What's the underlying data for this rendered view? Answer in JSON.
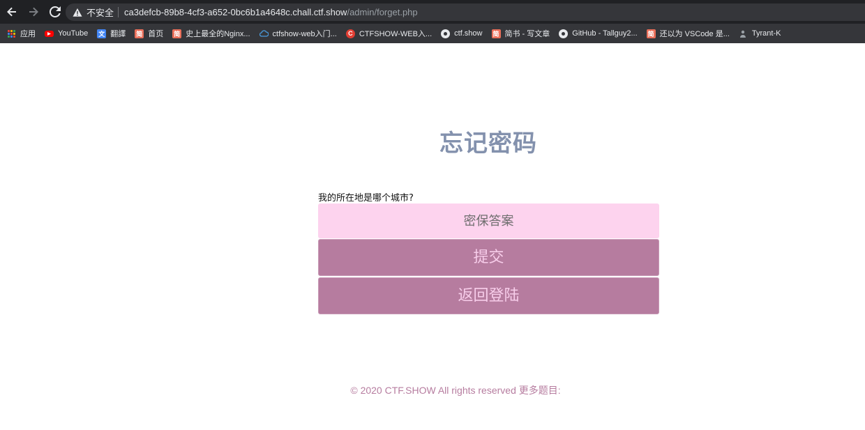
{
  "browser": {
    "security_label": "不安全",
    "url_host": "ca3defcb-89b8-4cf3-a652-0bc6b1a4648c.chall.ctf.show",
    "url_path": "/admin/forget.php",
    "bookmarks": [
      {
        "label": "应用",
        "icon": "apps-grid-icon"
      },
      {
        "label": "YouTube",
        "icon": "youtube-icon",
        "color": "#ff0000"
      },
      {
        "label": "翻譯",
        "icon": "translate-icon",
        "color": "#4285f4"
      },
      {
        "label": "首页",
        "icon": "jianshu-icon",
        "color": "#ea6f5a"
      },
      {
        "label": "史上最全的Nginx...",
        "icon": "jianshu-icon",
        "color": "#ea6f5a"
      },
      {
        "label": "ctfshow-web入门...",
        "icon": "cloud-icon",
        "color": "#4a9de0"
      },
      {
        "label": "CTFSHOW-WEB入...",
        "icon": "csdn-icon",
        "color": "#e33e33"
      },
      {
        "label": "ctf.show",
        "icon": "globe-icon",
        "color": "#e8eaed"
      },
      {
        "label": "简书 - 写文章",
        "icon": "jianshu-icon",
        "color": "#ea6f5a"
      },
      {
        "label": "GitHub - Tallguy2...",
        "icon": "github-icon",
        "color": "#e8eaed"
      },
      {
        "label": "还以为 VSCode 是...",
        "icon": "jianshu-icon",
        "color": "#ea6f5a"
      },
      {
        "label": "Tyrant-K",
        "icon": "person-icon",
        "color": "#9aa0a6"
      }
    ]
  },
  "page": {
    "title": "忘记密码",
    "question": "我的所在地是哪个城市?",
    "answer_placeholder": "密保答案",
    "submit_label": "提交",
    "back_label": "返回登陆",
    "footer": "© 2020 CTF.SHOW All rights reserved 更多题目:"
  },
  "colors": {
    "title": "#8391ad",
    "input_bg": "#fdd3ee",
    "button_bg": "#b67c9f",
    "button_text": "#f7cdea",
    "footer": "#b67c9f"
  }
}
